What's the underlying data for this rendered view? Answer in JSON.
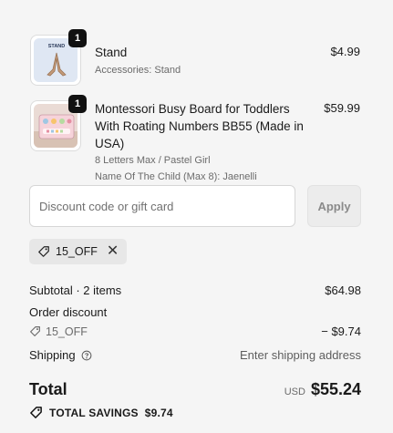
{
  "items": [
    {
      "quantity": "1",
      "title": "Stand",
      "lines": [
        "Accessories: Stand"
      ],
      "price": "$4.99",
      "thumb_label": "STAND"
    },
    {
      "quantity": "1",
      "title": "Montessori Busy Board for Toddlers With Roating Numbers BB55 (Made in USA)",
      "lines": [
        "8 Letters Max / Pastel Girl",
        "Name Of The Child (Max 8): Jaenelli"
      ],
      "price": "$59.99"
    }
  ],
  "discount": {
    "placeholder": "Discount code or gift card",
    "value": "",
    "apply_label": "Apply",
    "applied_code": "15_OFF"
  },
  "summary": {
    "subtotal_label": "Subtotal · 2 items",
    "subtotal_value": "$64.98",
    "order_discount_label": "Order discount",
    "order_discount_code": "15_OFF",
    "order_discount_value": "− $9.74",
    "shipping_label": "Shipping",
    "shipping_value": "Enter shipping address",
    "total_label": "Total",
    "currency": "USD",
    "total_value": "$55.24",
    "savings_label": "TOTAL SAVINGS",
    "savings_value": "$9.74"
  },
  "colors": {
    "background": "#f5f5f5",
    "badge": "#111111",
    "text": "#1a1a1a",
    "muted": "#6b6b6b"
  }
}
